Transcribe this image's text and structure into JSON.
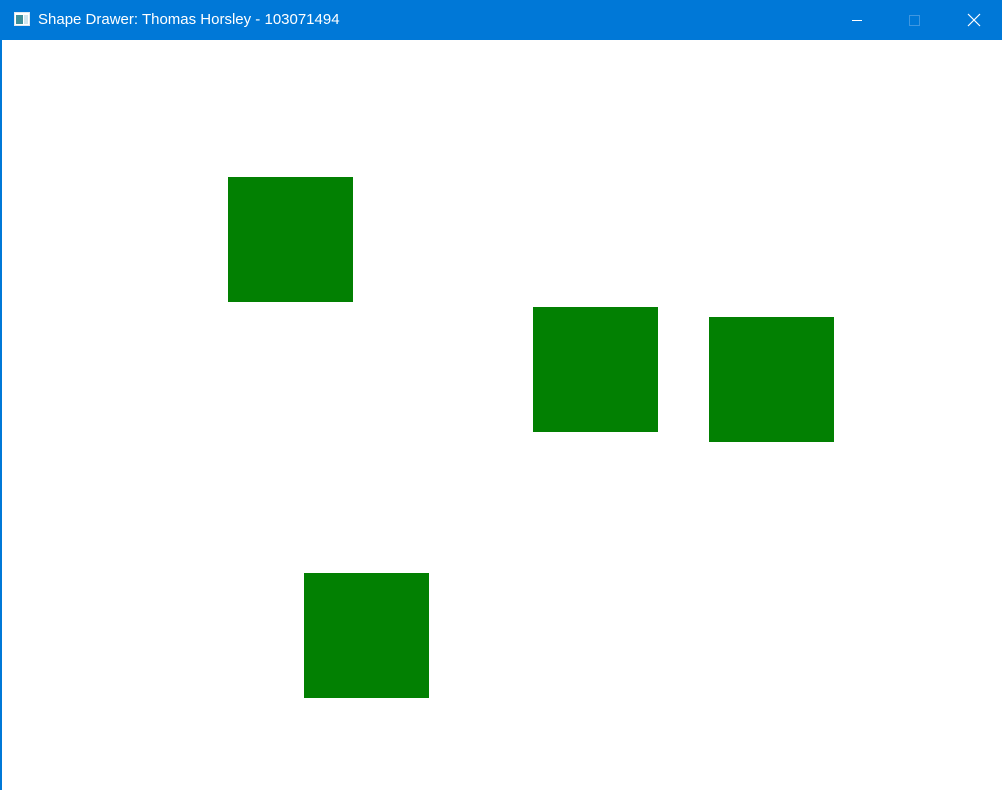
{
  "window": {
    "title": "Shape Drawer: Thomas Horsley - 103071494",
    "titlebar_color": "#0078d7",
    "icon": "app-window-icon",
    "controls": {
      "minimize_icon": "minimize-icon",
      "maximize_icon": "maximize-icon",
      "close_icon": "close-icon"
    }
  },
  "canvas": {
    "background": "#ffffff",
    "shape_color": "#028002",
    "shapes": [
      {
        "type": "rectangle"
      },
      {
        "type": "rectangle"
      },
      {
        "type": "rectangle"
      },
      {
        "type": "rectangle"
      }
    ]
  }
}
